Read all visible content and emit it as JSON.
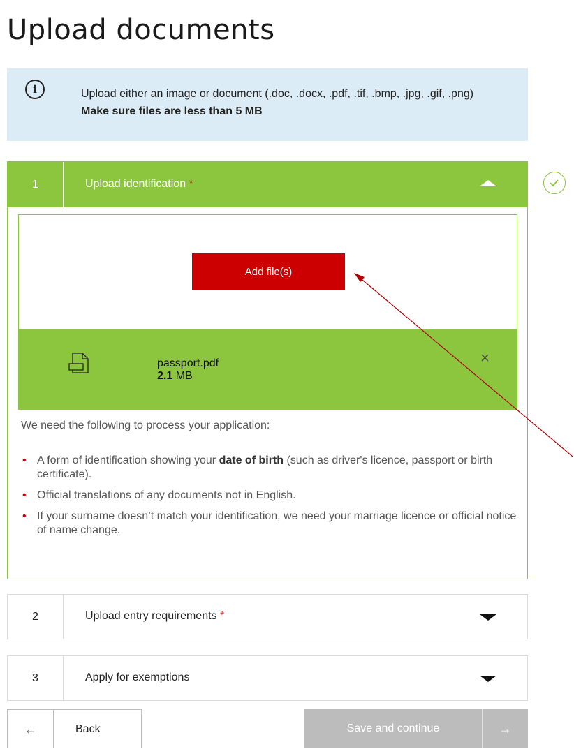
{
  "page": {
    "title": "Upload documents"
  },
  "info": {
    "icon": "info-icon",
    "text": "Upload either an image or document (.doc, .docx, .pdf, .tif, .bmp, .jpg, .gif, .png)",
    "text_bold": "Make sure files are less than 5 MB"
  },
  "sections": [
    {
      "number": "1",
      "title": "Upload identification",
      "required_mark": "*",
      "expanded": true,
      "complete": true
    },
    {
      "number": "2",
      "title": "Upload entry requirements",
      "required_mark": "*",
      "expanded": false
    },
    {
      "number": "3",
      "title": "Apply for exemptions",
      "expanded": false
    }
  ],
  "upload": {
    "add_button_label": "Add file(s)",
    "file": {
      "name": "passport.pdf",
      "size_value": "2.1",
      "size_unit": "MB",
      "icon": "file-document-icon",
      "remove_icon": "close-icon"
    }
  },
  "requirements": {
    "intro": "We need the following to process your application:",
    "items": [
      {
        "before": "A form of identification showing your ",
        "bold": "date of birth",
        "after": " (such as driver's licence, passport or birth certificate)."
      },
      {
        "before": "Official translations of any documents not in English.",
        "bold": "",
        "after": ""
      },
      {
        "before": "If your surname doesn’t match your identification, we need your marriage licence or official notice of name change.",
        "bold": "",
        "after": ""
      }
    ]
  },
  "nav": {
    "back_label": "Back",
    "back_icon": "←",
    "save_label": "Save and continue",
    "save_icon": "→"
  },
  "colors": {
    "accent_green": "#8cc63f",
    "primary_red": "#cc0000",
    "info_blue": "#dcecf6",
    "disabled_grey": "#bcbcbc",
    "annotation_arrow": "#b00000"
  }
}
